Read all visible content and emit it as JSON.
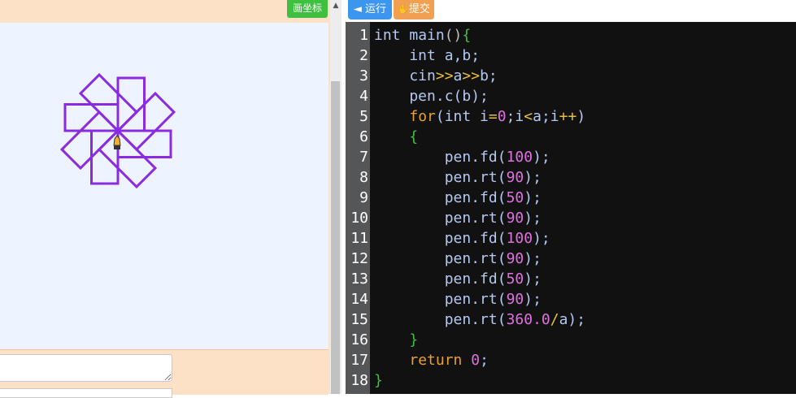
{
  "canvas_panel": {
    "draw_axes_button": "画坐标",
    "background_color": "#eef4ff",
    "pen_color": "#8a2be2"
  },
  "toolbar": {
    "run_button": "◄ 运行",
    "submit_button": "提交"
  },
  "code_lines": [
    [
      {
        "t": "int ",
        "c": "plain"
      },
      {
        "t": "main",
        "c": "plain"
      },
      {
        "t": "()",
        "c": "punct"
      },
      {
        "t": "{",
        "c": "brace"
      }
    ],
    [
      {
        "t": "    int ",
        "c": "plain"
      },
      {
        "t": "a,b;",
        "c": "plain"
      }
    ],
    [
      {
        "t": "    cin",
        "c": "plain"
      },
      {
        "t": ">>",
        "c": "op"
      },
      {
        "t": "a",
        "c": "plain"
      },
      {
        "t": ">>",
        "c": "op"
      },
      {
        "t": "b;",
        "c": "plain"
      }
    ],
    [
      {
        "t": "    pen.c(b);",
        "c": "plain"
      }
    ],
    [
      {
        "t": "    ",
        "c": "plain"
      },
      {
        "t": "for",
        "c": "kw"
      },
      {
        "t": "(int i",
        "c": "plain"
      },
      {
        "t": "=",
        "c": "op"
      },
      {
        "t": "0",
        "c": "num"
      },
      {
        "t": ";i",
        "c": "plain"
      },
      {
        "t": "<",
        "c": "op"
      },
      {
        "t": "a;i",
        "c": "plain"
      },
      {
        "t": "++",
        "c": "op"
      },
      {
        "t": ")",
        "c": "plain"
      }
    ],
    [
      {
        "t": "    ",
        "c": "plain"
      },
      {
        "t": "{",
        "c": "brace"
      }
    ],
    [
      {
        "t": "        pen.fd(",
        "c": "plain"
      },
      {
        "t": "100",
        "c": "num"
      },
      {
        "t": ");",
        "c": "plain"
      }
    ],
    [
      {
        "t": "        pen.rt(",
        "c": "plain"
      },
      {
        "t": "90",
        "c": "num"
      },
      {
        "t": ");",
        "c": "plain"
      }
    ],
    [
      {
        "t": "        pen.fd(",
        "c": "plain"
      },
      {
        "t": "50",
        "c": "num"
      },
      {
        "t": ");",
        "c": "plain"
      }
    ],
    [
      {
        "t": "        pen.rt(",
        "c": "plain"
      },
      {
        "t": "90",
        "c": "num"
      },
      {
        "t": ");",
        "c": "plain"
      }
    ],
    [
      {
        "t": "        pen.fd(",
        "c": "plain"
      },
      {
        "t": "100",
        "c": "num"
      },
      {
        "t": ");",
        "c": "plain"
      }
    ],
    [
      {
        "t": "        pen.rt(",
        "c": "plain"
      },
      {
        "t": "90",
        "c": "num"
      },
      {
        "t": ");",
        "c": "plain"
      }
    ],
    [
      {
        "t": "        pen.fd(",
        "c": "plain"
      },
      {
        "t": "50",
        "c": "num"
      },
      {
        "t": ");",
        "c": "plain"
      }
    ],
    [
      {
        "t": "        pen.rt(",
        "c": "plain"
      },
      {
        "t": "90",
        "c": "num"
      },
      {
        "t": ");",
        "c": "plain"
      }
    ],
    [
      {
        "t": "        pen.rt(",
        "c": "plain"
      },
      {
        "t": "360.0",
        "c": "num"
      },
      {
        "t": "/",
        "c": "op"
      },
      {
        "t": "a);",
        "c": "plain"
      }
    ],
    [
      {
        "t": "    ",
        "c": "plain"
      },
      {
        "t": "}",
        "c": "brace"
      }
    ],
    [
      {
        "t": "    ",
        "c": "plain"
      },
      {
        "t": "return ",
        "c": "kw"
      },
      {
        "t": "0",
        "c": "num"
      },
      {
        "t": ";",
        "c": "plain"
      }
    ],
    [
      {
        "t": "}",
        "c": "brace"
      }
    ]
  ],
  "colors": {
    "editor_bg": "#111111",
    "gutter_bg": "#555658",
    "keyword": "#e8a030",
    "number": "#e070e0",
    "operator": "#e8c040",
    "brace": "#40c040",
    "identifier": "#b5c8f0"
  },
  "icons": [
    "play-left-icon",
    "thumb-up-icon",
    "pen-cursor-icon",
    "scroll-up-arrow-icon",
    "resize-grip-icon"
  ]
}
